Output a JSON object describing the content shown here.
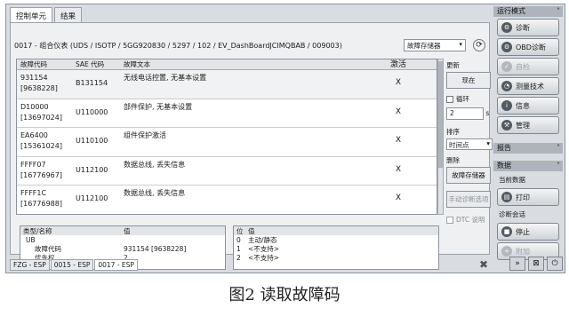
{
  "tabs": [
    "控制单元",
    "结果"
  ],
  "header": {
    "path": "0017 - 组合仪表 (UDS / ISOTP / 5GG920830 / 5297 / 102 / EV_DashBoardJCIMQBAB / 009003)",
    "memory_select": "故障存储器"
  },
  "table": {
    "columns": [
      "故障代码",
      "SAE 代码",
      "故障文本",
      "激活"
    ],
    "rows": [
      {
        "code": "931154",
        "code2": "[9638228]",
        "sae": "B131154",
        "text": "无线电话控置, 无基本设置",
        "active": "X"
      },
      {
        "code": "D10000",
        "code2": "[13697024]",
        "sae": "U110000",
        "text": "部件保护, 无基本设置",
        "active": "X"
      },
      {
        "code": "EA6400",
        "code2": "[15361024]",
        "sae": "U110100",
        "text": "组件保护激活",
        "active": "X"
      },
      {
        "code": "FFFF07",
        "code2": "[16776967]",
        "sae": "U112100",
        "text": "数据总线, 丢失信息",
        "active": "X"
      },
      {
        "code": "FFFF1C",
        "code2": "[16776988]",
        "sae": "U112100",
        "text": "数据总线, 丢失信息",
        "active": "X"
      }
    ]
  },
  "update": {
    "title": "更新",
    "now_btn": "现在",
    "loop_label": "循环",
    "interval": "2",
    "unit": "s",
    "order_label": "排序",
    "order_value": "时间点",
    "delete_label": "删除",
    "delete_btn": "故障存储器",
    "manual_btn": "手动诊断选项",
    "dtc_label": "DTC 说明"
  },
  "detail_left": {
    "headers": [
      "类型/名称",
      "值"
    ],
    "rows": [
      {
        "name": "UB",
        "value": ""
      },
      {
        "name": "故障代码",
        "value": "931154 [9638228]"
      },
      {
        "name": "优先权",
        "value": "2"
      }
    ]
  },
  "detail_right": {
    "headers": [
      "位",
      "值"
    ],
    "rows": [
      {
        "bit": "0",
        "value": "主动/静态"
      },
      {
        "bit": "1",
        "value": "<不支持>"
      },
      {
        "bit": "2",
        "value": "<不支持>"
      }
    ]
  },
  "status_tabs": [
    "FZG - ESP",
    "0015 - ESP",
    "0017 - ESP"
  ],
  "right_panel": {
    "mode_title": "运行模式",
    "mode_buttons": [
      "诊断",
      "OBD诊断",
      "自检",
      "测量技术",
      "信息",
      "管理"
    ],
    "report_title": "报告",
    "data_title": "数据",
    "data_label": "当前数据",
    "print_btn": "打印",
    "diag_label": "诊断会话",
    "stop_btn": "停止",
    "extra_btn": "附加"
  },
  "caption": "图2  读取故障码"
}
